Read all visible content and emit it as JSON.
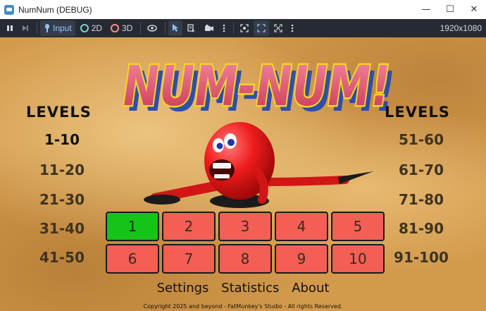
{
  "window": {
    "title": "NumNum (DEBUG)",
    "controls": {
      "minimize": "—",
      "maximize": "☐",
      "close": "✕"
    }
  },
  "toolbar": {
    "pause_icon": "pause-icon",
    "next_frame_icon": "next-frame-icon",
    "input_label": "Input",
    "mode_2d_label": "2D",
    "mode_3d_label": "3D",
    "resolution": "1920x1080",
    "colors": {
      "accent": "#8fc3ff",
      "mode_2d": "#7fd1c8",
      "mode_3d": "#ff8a8a"
    }
  },
  "game": {
    "logo_text": "NUM-NUM!",
    "levels_heading_left": "LEVELS",
    "levels_heading_right": "LEVELS",
    "left_ranges": [
      "1-10",
      "11-20",
      "21-30",
      "31-40",
      "41-50"
    ],
    "right_ranges": [
      "51-60",
      "61-70",
      "71-80",
      "81-90",
      "91-100"
    ],
    "current_range": "1-10",
    "level_buttons": [
      {
        "label": "1",
        "state": "completed"
      },
      {
        "label": "2",
        "state": "available"
      },
      {
        "label": "3",
        "state": "available"
      },
      {
        "label": "4",
        "state": "available"
      },
      {
        "label": "5",
        "state": "available"
      },
      {
        "label": "6",
        "state": "available"
      },
      {
        "label": "7",
        "state": "available"
      },
      {
        "label": "8",
        "state": "available"
      },
      {
        "label": "9",
        "state": "available"
      },
      {
        "label": "10",
        "state": "available"
      }
    ],
    "menu": {
      "settings": "Settings",
      "statistics": "Statistics",
      "about": "About"
    },
    "copyright": "Copyright 2025 and beyond - FatMunkey's Studio - All rights Reserved.",
    "colors": {
      "completed": "#16c418",
      "available": "#f45f55",
      "background": "#d39a4c"
    }
  }
}
